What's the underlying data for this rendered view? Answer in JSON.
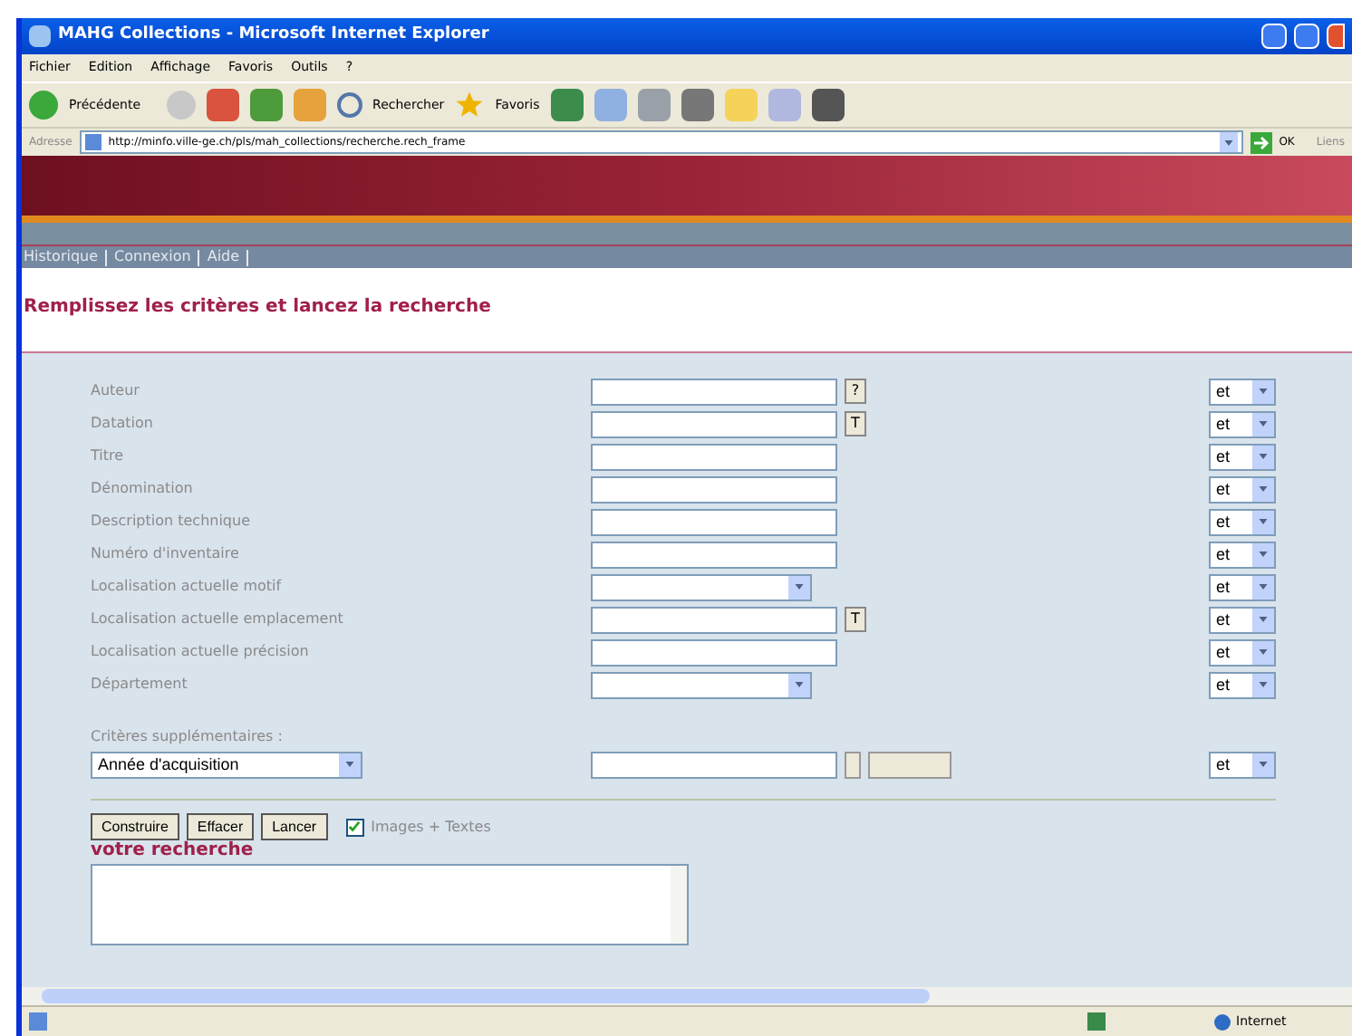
{
  "window": {
    "title": "MAHG Collections - Microsoft Internet Explorer"
  },
  "menu": [
    "Fichier",
    "Edition",
    "Affichage",
    "Favoris",
    "Outils",
    "?"
  ],
  "toolbar": {
    "back": "Précédente",
    "search": "Rechercher",
    "favorites": "Favoris"
  },
  "address_bar": {
    "label": "Adresse",
    "value": "http://minfo.ville-ge.ch/pls/mah_collections/recherche.rech_frame",
    "go": "OK",
    "links": "Liens"
  },
  "nav_links": [
    "Historique",
    "Connexion",
    "Aide"
  ],
  "heading": "Remplissez les critères et lancez la recherche",
  "fields": [
    {
      "label": "Auteur",
      "kind": "text",
      "extra": "?",
      "operator": "et"
    },
    {
      "label": "Datation",
      "kind": "text",
      "extra": "T",
      "operator": "et"
    },
    {
      "label": "Titre",
      "kind": "text",
      "operator": "et"
    },
    {
      "label": "Dénomination",
      "kind": "text",
      "operator": "et"
    },
    {
      "label": "Description technique",
      "kind": "text",
      "operator": "et"
    },
    {
      "label": "Numéro d'inventaire",
      "kind": "text",
      "operator": "et"
    },
    {
      "label": "Localisation actuelle motif",
      "kind": "select",
      "operator": "et"
    },
    {
      "label": "Localisation actuelle emplacement",
      "kind": "text",
      "extra": "T",
      "operator": "et"
    },
    {
      "label": "Localisation actuelle précision",
      "kind": "text",
      "operator": "et"
    },
    {
      "label": "Département",
      "kind": "select",
      "operator": "et"
    }
  ],
  "extra_criteria": {
    "label": "Critères supplémentaires :",
    "criterion": "Année d'acquisition",
    "operator": "et"
  },
  "buttons": [
    "Construire",
    "Effacer",
    "Lancer"
  ],
  "images_texts": {
    "label": "Images + Textes",
    "checked": true
  },
  "query": {
    "label": "votre recherche"
  },
  "status_bar": {
    "zone": "Internet"
  }
}
